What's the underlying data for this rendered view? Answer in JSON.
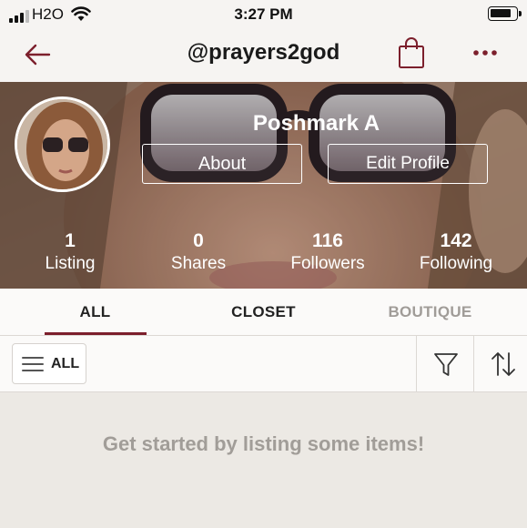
{
  "status_bar": {
    "carrier": "H2O",
    "time": "3:27 PM",
    "icons": [
      "cellular-signal-icon",
      "wifi-icon",
      "battery-icon"
    ]
  },
  "nav": {
    "title": "@prayers2god",
    "icons": [
      "back-arrow-icon",
      "shopping-bag-icon",
      "more-icon"
    ],
    "accent_color": "#7c1f2c"
  },
  "profile": {
    "name": "Poshmark A",
    "about_label": "About",
    "edit_label": "Edit Profile",
    "stats": [
      {
        "value": "1",
        "label": "Listing"
      },
      {
        "value": "0",
        "label": "Shares"
      },
      {
        "value": "116",
        "label": "Followers"
      },
      {
        "value": "142",
        "label": "Following"
      }
    ]
  },
  "tabs": [
    {
      "label": "ALL",
      "active": true
    },
    {
      "label": "CLOSET",
      "active": false
    },
    {
      "label": "BOUTIQUE",
      "active": false
    }
  ],
  "filter": {
    "all_label": "ALL",
    "icons": [
      "menu-icon",
      "filter-icon",
      "sort-icon"
    ]
  },
  "empty_state": {
    "message": "Get started by listing some items!"
  }
}
